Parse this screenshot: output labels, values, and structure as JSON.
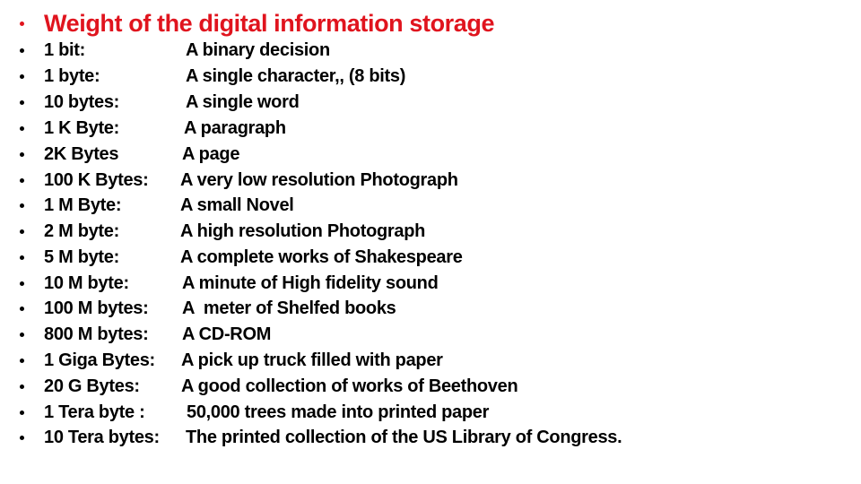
{
  "title": "Weight of the digital information  storage",
  "colors": {
    "title": "#e0141e",
    "text": "#000000",
    "background": "#ffffff"
  },
  "bullet_icon": "bullet-dot",
  "items": [
    {
      "term": "1 bit:",
      "description": "A binary decision"
    },
    {
      "term": "1 byte:",
      "description": "A single character,, (8 bits)"
    },
    {
      "term": "10 bytes:",
      "description": "A single word"
    },
    {
      "term": "1 K Byte:",
      "description": "A paragraph"
    },
    {
      "term": "2K Bytes",
      "description": "A page"
    },
    {
      "term": "100 K Bytes:",
      "description": "A very low resolution Photograph"
    },
    {
      "term": "1 M Byte:",
      "description": "A small Novel"
    },
    {
      "term": "2 M byte:",
      "description": "A high resolution Photograph"
    },
    {
      "term": "5 M byte:",
      "description": "A complete works of Shakespeare"
    },
    {
      "term": "10 M byte:",
      "description": "A minute of High fidelity sound"
    },
    {
      "term": "100 M bytes:",
      "description": "A  meter of Shelfed books"
    },
    {
      "term": "800 M bytes:",
      "description": "A CD-ROM"
    },
    {
      "term": "1 Giga Bytes:",
      "description": "A pick up truck filled with paper"
    },
    {
      "term": "20 G Bytes:",
      "description": "A good collection of works of Beethoven"
    },
    {
      "term": "1 Tera byte :",
      "description": "50,000 trees made into printed paper"
    },
    {
      "term": "10 Tera bytes:",
      "description": "The printed collection of the US Library of Congress."
    }
  ]
}
